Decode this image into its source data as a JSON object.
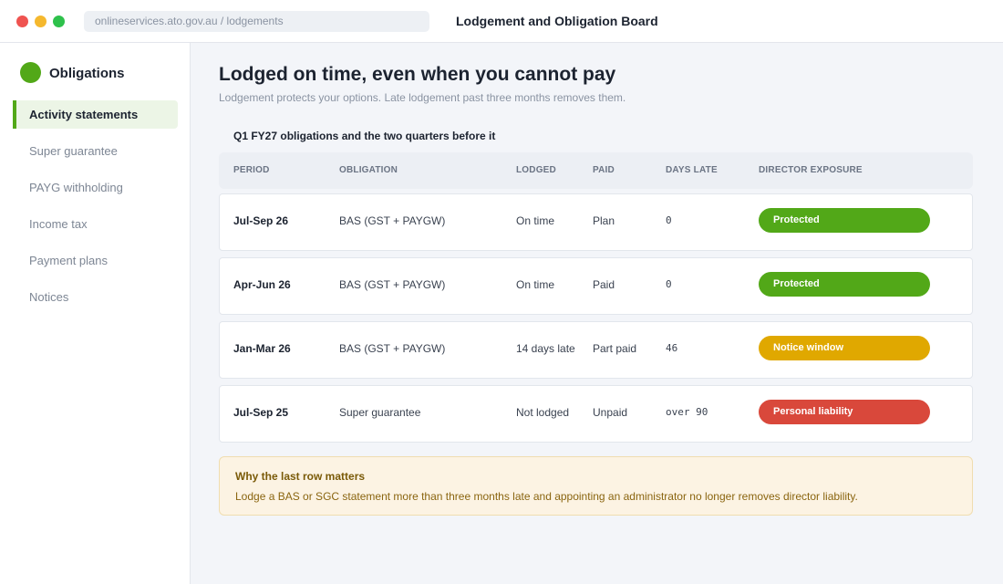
{
  "window": {
    "url": "onlineservices.ato.gov.au / lodgements",
    "title": "Lodgement and Obligation Board"
  },
  "sidebar": {
    "brand": "Obligations",
    "items": [
      {
        "label": "Activity statements",
        "active": true
      },
      {
        "label": "Super guarantee",
        "active": false
      },
      {
        "label": "PAYG withholding",
        "active": false
      },
      {
        "label": "Income tax",
        "active": false
      },
      {
        "label": "Payment plans",
        "active": false
      },
      {
        "label": "Notices",
        "active": false
      }
    ]
  },
  "main": {
    "title": "Lodged on time, even when you cannot pay",
    "subtitle": "Lodgement protects your options. Late lodgement past three months removes them.",
    "section_title": "Q1 FY27 obligations and the two quarters before it",
    "table": {
      "headers": {
        "period": "PERIOD",
        "obligation": "OBLIGATION",
        "lodged": "LODGED",
        "paid": "PAID",
        "days_late": "DAYS LATE",
        "director_exposure": "DIRECTOR EXPOSURE"
      },
      "rows": [
        {
          "period": "Jul-Sep 26",
          "obligation": "BAS (GST + PAYGW)",
          "lodged": "On time",
          "paid": "Plan",
          "days_late": "0",
          "exposure": "Protected",
          "exposure_color": "#52a818"
        },
        {
          "period": "Apr-Jun 26",
          "obligation": "BAS (GST + PAYGW)",
          "lodged": "On time",
          "paid": "Paid",
          "days_late": "0",
          "exposure": "Protected",
          "exposure_color": "#52a818"
        },
        {
          "period": "Jan-Mar 26",
          "obligation": "BAS (GST + PAYGW)",
          "lodged": "14 days late",
          "paid": "Part paid",
          "days_late": "46",
          "exposure": "Notice window",
          "exposure_color": "#e0a800"
        },
        {
          "period": "Jul-Sep 25",
          "obligation": "Super guarantee",
          "lodged": "Not lodged",
          "paid": "Unpaid",
          "days_late": "over 90",
          "exposure": "Personal liability",
          "exposure_color": "#d9483b"
        }
      ]
    },
    "callout": {
      "title": "Why the last row matters",
      "body": "Lodge a BAS or SGC statement more than three months late and appointing an administrator no longer removes director liability."
    }
  },
  "colors": {
    "accent": "#52a818",
    "warning": "#e0a800",
    "danger": "#d9483b",
    "window_close": "#ef5350",
    "window_minimize": "#f5b82e",
    "window_maximize": "#2ec14b"
  },
  "icons": {
    "brand": "green-circle-logo"
  }
}
